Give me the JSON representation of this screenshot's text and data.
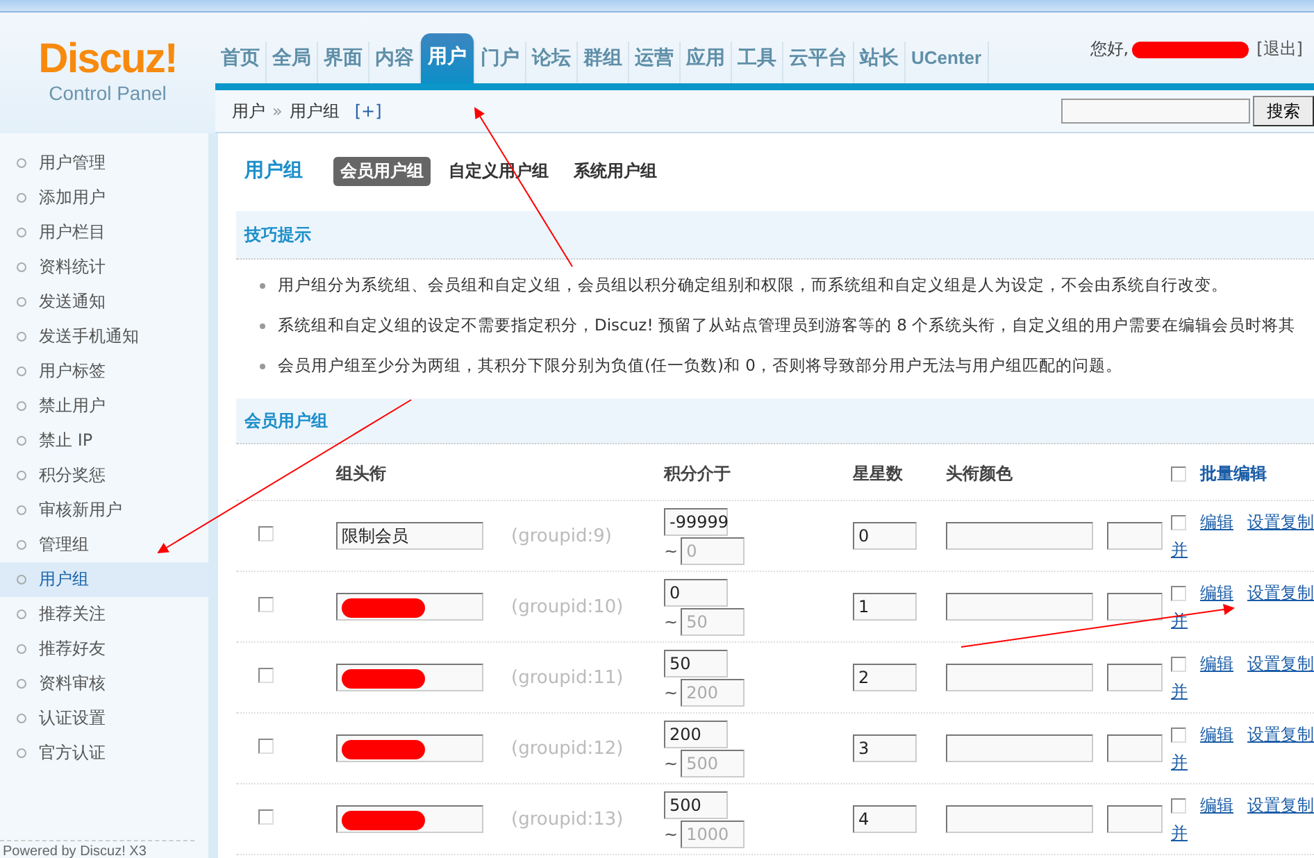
{
  "logo": {
    "name": "Discuz!",
    "subtitle": "Control Panel"
  },
  "nav": [
    {
      "label": "首页",
      "selected": false
    },
    {
      "label": "全局",
      "selected": false
    },
    {
      "label": "界面",
      "selected": false
    },
    {
      "label": "内容",
      "selected": false
    },
    {
      "label": "用户",
      "selected": true
    },
    {
      "label": "门户",
      "selected": false
    },
    {
      "label": "论坛",
      "selected": false
    },
    {
      "label": "群组",
      "selected": false
    },
    {
      "label": "运营",
      "selected": false
    },
    {
      "label": "应用",
      "selected": false
    },
    {
      "label": "工具",
      "selected": false
    },
    {
      "label": "云平台",
      "selected": false
    },
    {
      "label": "站长",
      "selected": false
    },
    {
      "label": "UCenter",
      "selected": false
    }
  ],
  "user": {
    "greeting": "您好,",
    "name_redacted": true,
    "logout": "[退出]"
  },
  "breadcrumb": {
    "items": [
      "用户",
      "用户组"
    ],
    "separator": "»",
    "add": "[+]"
  },
  "search": {
    "button": "搜索"
  },
  "sidebar": {
    "items": [
      {
        "label": "用户管理",
        "selected": false
      },
      {
        "label": "添加用户",
        "selected": false
      },
      {
        "label": "用户栏目",
        "selected": false
      },
      {
        "label": "资料统计",
        "selected": false
      },
      {
        "label": "发送通知",
        "selected": false
      },
      {
        "label": "发送手机通知",
        "selected": false
      },
      {
        "label": "用户标签",
        "selected": false
      },
      {
        "label": "禁止用户",
        "selected": false
      },
      {
        "label": "禁止 IP",
        "selected": false
      },
      {
        "label": "积分奖惩",
        "selected": false
      },
      {
        "label": "审核新用户",
        "selected": false
      },
      {
        "label": "管理组",
        "selected": false
      },
      {
        "label": "用户组",
        "selected": true
      },
      {
        "label": "推荐关注",
        "selected": false
      },
      {
        "label": "推荐好友",
        "selected": false
      },
      {
        "label": "资料审核",
        "selected": false
      },
      {
        "label": "认证设置",
        "selected": false
      },
      {
        "label": "官方认证",
        "selected": false
      }
    ],
    "footer": "Powered by Discuz! X3"
  },
  "page": {
    "title": "用户组",
    "tabs": [
      {
        "label": "会员用户组",
        "selected": true
      },
      {
        "label": "自定义用户组",
        "selected": false
      },
      {
        "label": "系统用户组",
        "selected": false
      }
    ]
  },
  "tips": {
    "title": "技巧提示",
    "items": [
      "用户组分为系统组、会员组和自定义组，会员组以积分确定组别和权限，而系统组和自定义组是人为设定，不会由系统自行改变。",
      "系统组和自定义组的设定不需要指定积分，Discuz! 预留了从站点管理员到游客等的 8 个系统头衔，自定义组的用户需要在编辑会员时将其",
      "会员用户组至少分为两组，其积分下限分别为负值(任一负数)和 0，否则将导致部分用户无法与用户组匹配的问题。"
    ]
  },
  "table": {
    "section": "会员用户组",
    "columns": [
      "组头衔",
      "积分介于",
      "星星数",
      "头衔颜色"
    ],
    "batch": {
      "label": "批量编辑",
      "checked": false
    },
    "rows": [
      {
        "checked": false,
        "title": "限制会员",
        "redacted": false,
        "groupid": "(groupid:9)",
        "score_min": "-99999",
        "range_sep": "~",
        "score_max": "0",
        "max_disabled": true,
        "stars": "0",
        "edit": "编辑",
        "copy": "设置复制",
        "merge": "并",
        "op_checked": false
      },
      {
        "checked": false,
        "title": "",
        "redacted": true,
        "groupid": "(groupid:10)",
        "score_min": "0",
        "range_sep": "~",
        "score_max": "50",
        "max_disabled": true,
        "stars": "1",
        "edit": "编辑",
        "copy": "设置复制",
        "merge": "并",
        "op_checked": false
      },
      {
        "checked": false,
        "title": "",
        "redacted": true,
        "groupid": "(groupid:11)",
        "score_min": "50",
        "range_sep": "~",
        "score_max": "200",
        "max_disabled": true,
        "stars": "2",
        "edit": "编辑",
        "copy": "设置复制",
        "merge": "并",
        "op_checked": false
      },
      {
        "checked": false,
        "title": "",
        "redacted": true,
        "groupid": "(groupid:12)",
        "score_min": "200",
        "range_sep": "~",
        "score_max": "500",
        "max_disabled": true,
        "stars": "3",
        "edit": "编辑",
        "copy": "设置复制",
        "merge": "并",
        "op_checked": false
      },
      {
        "checked": false,
        "title": "",
        "redacted": true,
        "groupid": "(groupid:13)",
        "score_min": "500",
        "range_sep": "~",
        "score_max": "1000",
        "max_disabled": true,
        "stars": "4",
        "edit": "编辑",
        "copy": "设置复制",
        "merge": "并",
        "op_checked": false
      }
    ]
  }
}
